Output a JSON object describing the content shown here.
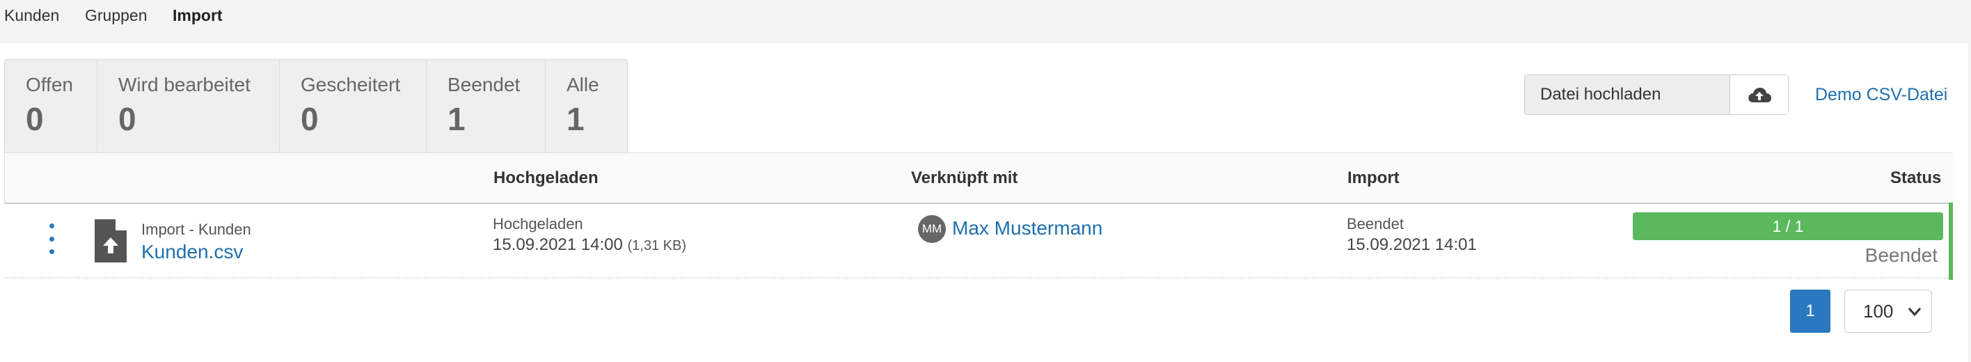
{
  "nav": {
    "items": [
      {
        "label": "Kunden"
      },
      {
        "label": "Gruppen"
      },
      {
        "label": "Import"
      }
    ]
  },
  "tabs": [
    {
      "label": "Offen",
      "count": "0"
    },
    {
      "label": "Wird bearbeitet",
      "count": "0"
    },
    {
      "label": "Gescheitert",
      "count": "0"
    },
    {
      "label": "Beendet",
      "count": "1"
    },
    {
      "label": "Alle",
      "count": "1"
    }
  ],
  "upload": {
    "field_label": "Datei hochladen",
    "icon": "cloud-upload-icon",
    "demo_link": "Demo CSV-Datei"
  },
  "table": {
    "headers": {
      "uploaded": "Hochgeladen",
      "linked": "Verknüpft mit",
      "import": "Import",
      "status": "Status"
    },
    "row": {
      "type_label": "Import - Kunden",
      "file_name": "Kunden.csv",
      "uploaded_label": "Hochgeladen",
      "uploaded_at": "15.09.2021 14:00",
      "size": "(1,31 KB)",
      "avatar_initials": "MM",
      "person": "Max Mustermann",
      "import_label": "Beendet",
      "import_at": "15.09.2021 14:01",
      "progress_text": "1 / 1",
      "progress_fraction": 1,
      "status": "Beendet"
    }
  },
  "pagination": {
    "current_page": "1",
    "per_page": "100"
  },
  "colors": {
    "link": "#1f6fad",
    "primary": "#2a78c0",
    "success": "#5cb85c"
  }
}
